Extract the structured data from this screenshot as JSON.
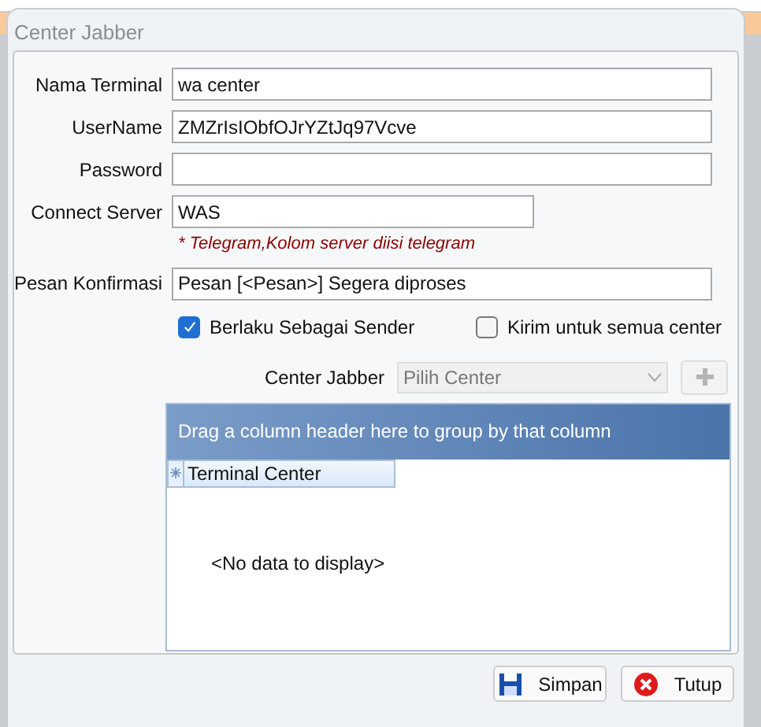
{
  "window": {
    "title": "Center Jabber"
  },
  "fields": [
    {
      "label": "Nama Terminal",
      "value": "wa center",
      "kind": "wide"
    },
    {
      "label": "UserName",
      "value": "ZMZrIsIObfOJrYZtJq97Vcve",
      "kind": "wide"
    },
    {
      "label": "Password",
      "kind": "wide"
    },
    {
      "label": "Connect Server",
      "value": "WAS",
      "kind": "short",
      "note": "* Telegram,Kolom  server diisi telegram"
    },
    {
      "label": "Pesan Konfirmasi",
      "value": "Pesan [<Pesan>] Segera diproses",
      "kind": "wide"
    }
  ],
  "checkboxes": [
    {
      "label": "Berlaku Sebagai Sender",
      "checked": true
    },
    {
      "label": "Kirim untuk semua center",
      "checked": false
    }
  ],
  "center_select": {
    "label": "Center Jabber",
    "placeholder": "Pilih Center"
  },
  "grid": {
    "group_hint": "Drag a column header here to group by that column",
    "columns": [
      "Terminal Center"
    ],
    "empty_text": "<No data to display>"
  },
  "buttons": [
    {
      "label": "Simpan",
      "kind": "save"
    },
    {
      "label": "Tutup",
      "kind": "close"
    }
  ]
}
